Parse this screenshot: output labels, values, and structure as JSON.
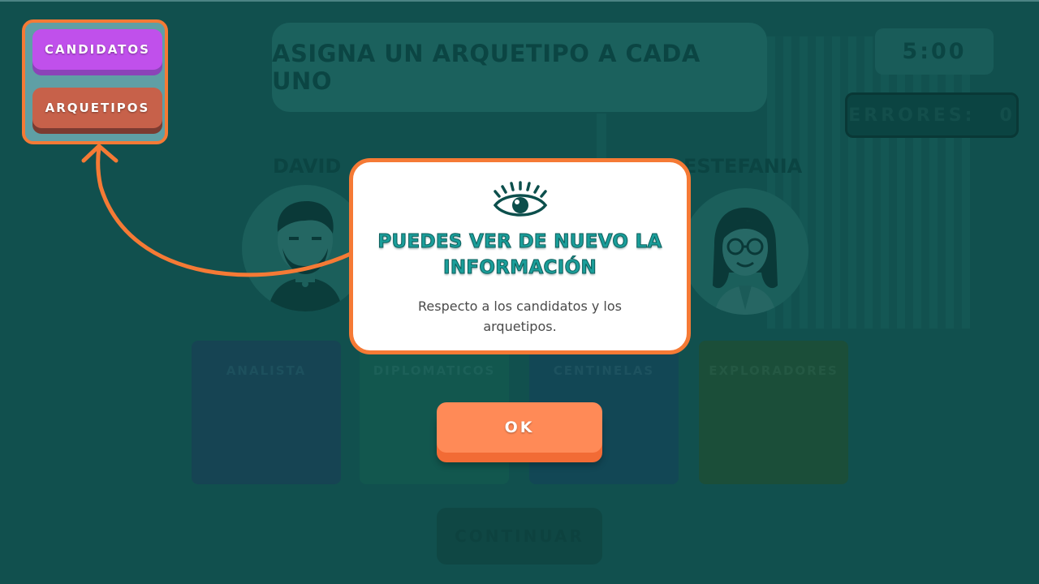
{
  "game": {
    "title": "ASIGNA UN ARQUETIPO A CADA UNO",
    "timer": "5:00",
    "errors_label": "ERRORES:",
    "errors_count": "0",
    "candidates": [
      {
        "name": "DAVID"
      },
      {
        "name": "ESTEFANIA"
      }
    ],
    "categories": [
      {
        "label": "ANALISTA",
        "color": "#215a74",
        "text_color": "#2d6f86"
      },
      {
        "label": "DIPLOMATICOS",
        "color": "#1a7a6c",
        "text_color": "#2b8a7c"
      },
      {
        "label": "CENTINELAS",
        "color": "#1a5f78",
        "text_color": "#2e7288"
      },
      {
        "label": "EXPLORADORES",
        "color": "#2a6b48",
        "text_color": "#3a7d58"
      }
    ],
    "continue_label": "CONTINUAR"
  },
  "menu": {
    "candidates_label": "CANDIDATOS",
    "archetypes_label": "ARQUETIPOS"
  },
  "modal": {
    "icon": "eye-icon",
    "title_line1": "PUEDES VER DE NUEVO LA",
    "title_line2": "INFORMACIÓN",
    "body_line1": "Respecto a los candidatos y los",
    "body_line2": "arquetipos.",
    "ok_label": "OK"
  },
  "colors": {
    "accent": "#f57a35",
    "ok_button": "#ff8a57",
    "candidates_button": "#c050eb",
    "archetypes_button": "#c7614a",
    "title_teal": "#1a9e9a"
  }
}
